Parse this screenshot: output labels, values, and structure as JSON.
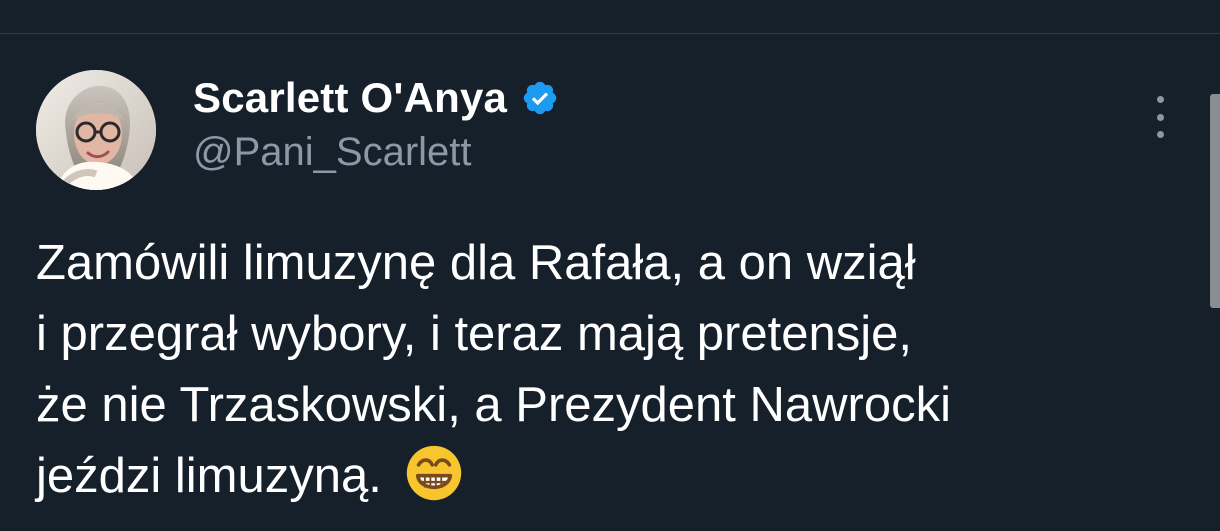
{
  "tweet": {
    "author": {
      "display_name": "Scarlett O'Anya",
      "handle": "@Pani_Scarlett",
      "verified": true,
      "avatar_icon": "profile-photo-woman-with-glasses"
    },
    "text_lines": [
      "Zamówili limuzynę dla Rafała, a on wziął",
      "i przegrał wybory, i teraz mają pretensje,",
      "że nie Trzaskowski, a Prezydent Nawrocki",
      "jeździ limuzyną."
    ],
    "trailing_emoji": "grinning-face-with-smiling-eyes-emoji",
    "more_icon": "more-vertical-icon"
  },
  "theme": {
    "background": "#15202b",
    "text": "#ffffff",
    "secondary_text": "#8b98a5",
    "verified_blue": "#1d9bf0",
    "divider": "#2f3b47"
  }
}
